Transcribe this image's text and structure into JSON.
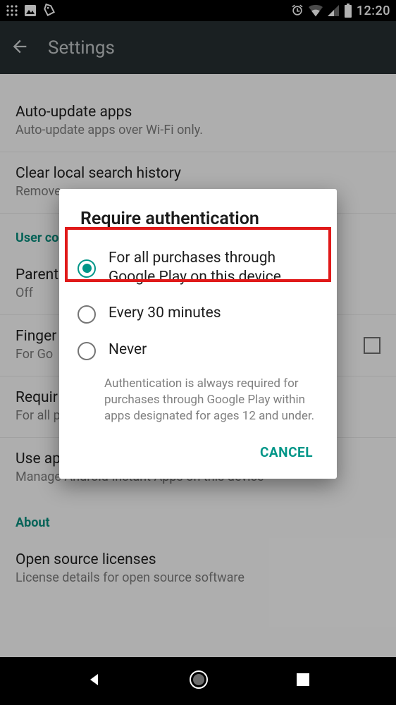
{
  "status": {
    "time": "12:20"
  },
  "appbar": {
    "title": "Settings"
  },
  "settings": {
    "auto_update": {
      "title": "Auto-update apps",
      "sub": "Auto-update apps over Wi-Fi only."
    },
    "clear_history": {
      "title": "Clear local search history",
      "sub": "Remove"
    },
    "section_user": "User co",
    "parental": {
      "title": "Parent",
      "sub": "Off"
    },
    "fingerprint": {
      "title": "Finger",
      "sub": "For Go"
    },
    "require": {
      "title": "Requir",
      "sub": "For all p"
    },
    "instant": {
      "title": "Use apps without installation",
      "sub": "Manage Android Instant Apps on this device"
    },
    "section_about": "About",
    "licenses": {
      "title": "Open source licenses",
      "sub": "License details for open source software"
    }
  },
  "dialog": {
    "title": "Require authentication",
    "options": {
      "all": "For all purchases through Google Play on this device",
      "thirty": "Every 30 minutes",
      "never": "Never"
    },
    "note": "Authentication is always required for purchases through Google Play within apps designated for ages 12 and under.",
    "cancel": "CANCEL"
  },
  "colors": {
    "accent": "#009688",
    "highlight": "#e01919"
  }
}
